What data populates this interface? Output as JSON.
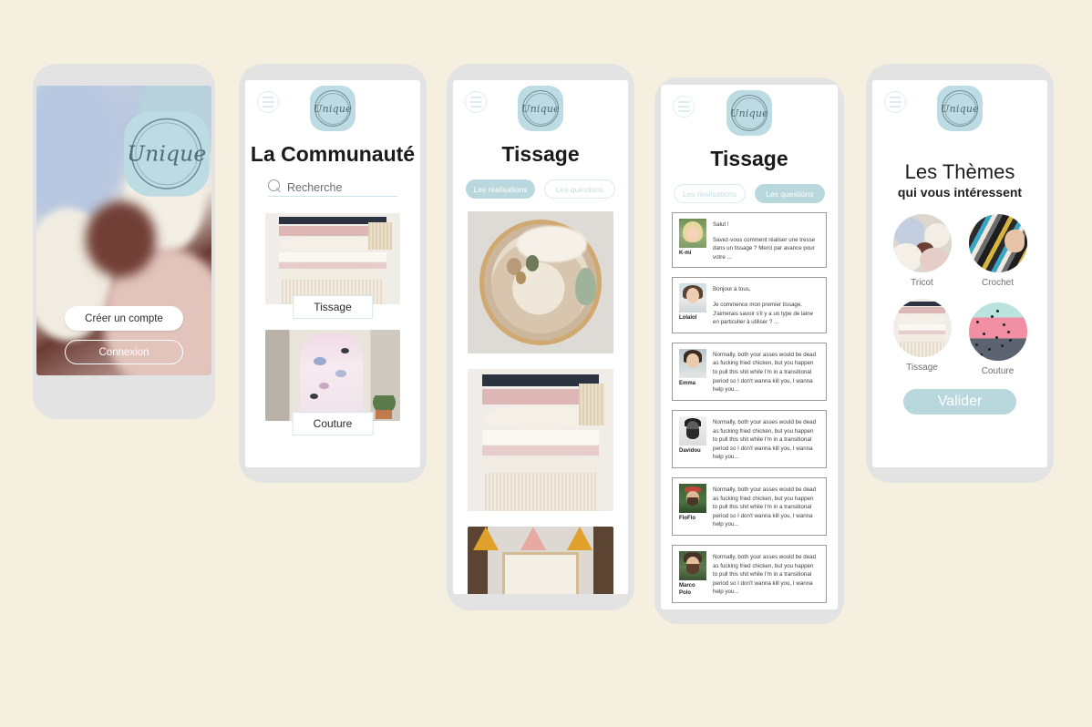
{
  "canvas": {
    "background_color": "#f5efdf",
    "frame_color": "#e3e3e3",
    "accent_color": "#b9d8dd"
  },
  "brand": {
    "name": "Unique"
  },
  "icons": {
    "menu": "hamburger-menu-icon",
    "search": "search-icon"
  },
  "screens": [
    {
      "id": "splash",
      "name": "splash-screen",
      "logo_text": "Unique",
      "buttons": [
        {
          "label": "Créer un compte",
          "style": "filled"
        },
        {
          "label": "Connexion",
          "style": "outline"
        }
      ]
    },
    {
      "id": "community",
      "name": "community-screen",
      "logo_text": "Unique",
      "title": "La Communauté",
      "search": {
        "placeholder": "Recherche",
        "value": ""
      },
      "categories": [
        {
          "label": "Tissage",
          "image": "weaving-wall-hanging-photo"
        },
        {
          "label": "Couture",
          "image": "floral-dress-photo"
        }
      ]
    },
    {
      "id": "tissage-realisations",
      "name": "tissage-realisations-screen",
      "logo_text": "Unique",
      "title": "Tissage",
      "tabs": [
        {
          "label": "Les réalisations",
          "active": true
        },
        {
          "label": "Les questions",
          "active": false
        }
      ],
      "posts": [
        {
          "image": "round-woven-hoop-photo"
        },
        {
          "image": "weaving-wall-hanging-photo"
        },
        {
          "image": "triangle-banner-wall-photo"
        }
      ]
    },
    {
      "id": "tissage-questions",
      "name": "tissage-questions-screen",
      "logo_text": "Unique",
      "title": "Tissage",
      "tabs": [
        {
          "label": "Les réalisations",
          "active": false
        },
        {
          "label": "Les questions",
          "active": true
        }
      ],
      "questions": [
        {
          "username": "K-mi",
          "avatar": "blonde-woman-avatar",
          "greeting": "Salut !",
          "body": "Savez-vous comment réaliser une tresse dans un tissage ?\nMerci par avance pour votre ..."
        },
        {
          "username": "Lolalol",
          "avatar": "brunette-woman-avatar",
          "greeting": "Bonjour à tous,",
          "body": "Je commence mon premier tissage.\nJ'aimerais savoir s'il y a un type de laine en particulier à utiliser ? ..."
        },
        {
          "username": "Emma",
          "avatar": "dark-hair-woman-avatar",
          "greeting": "",
          "body": "Normally, both your asses would be dead as fucking fried chicken, but you happen to pull this shit while I'm in a transitional period so I don't wanna kill you, I wanna help you..."
        },
        {
          "username": "Davidou",
          "avatar": "bearded-man-bw-avatar",
          "greeting": "",
          "body": "Normally, both your asses would be dead as fucking fried chicken, but you happen to pull this shit while I'm in a transitional period so I don't wanna kill you, I wanna help you..."
        },
        {
          "username": "FloFlo",
          "avatar": "man-red-cap-avatar",
          "greeting": "",
          "body": "Normally, both your asses would be dead as fucking fried chicken, but you happen to pull this shit while I'm in a transitional period so I don't wanna kill you, I wanna help you..."
        },
        {
          "username": "Marco Polo",
          "avatar": "curly-bearded-man-avatar",
          "greeting": "",
          "body": "Normally, both your asses would be dead as fucking fried chicken, but you happen to pull this shit while I'm in a transitional period so I don't wanna kill you, I wanna help you..."
        }
      ]
    },
    {
      "id": "themes",
      "name": "themes-screen",
      "logo_text": "Unique",
      "title_line1": "Les Thèmes",
      "title_line2": "qui vous intéressent",
      "themes": [
        {
          "label": "Tricot",
          "image": "yarn-balls-photo"
        },
        {
          "label": "Crochet",
          "image": "crochet-blanket-photo"
        },
        {
          "label": "Tissage",
          "image": "weaving-wall-hanging-photo"
        },
        {
          "label": "Couture",
          "image": "polka-dot-fabric-photo"
        }
      ],
      "submit_button": "Valider"
    }
  ]
}
